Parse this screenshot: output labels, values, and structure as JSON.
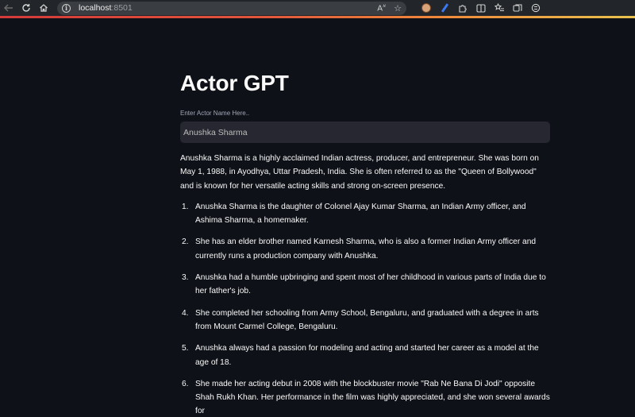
{
  "browser": {
    "url_host": "localhost",
    "url_port": ":8501"
  },
  "app": {
    "title": "Actor GPT",
    "input_label": "Enter Actor Name Here..",
    "input_value": "Anushka Sharma",
    "intro": "Anushka Sharma is a highly acclaimed Indian actress, producer, and entrepreneur. She was born on May 1, 1988, in Ayodhya, Uttar Pradesh, India. She is often referred to as the \"Queen of Bollywood\" and is known for her versatile acting skills and strong on-screen presence.",
    "facts": [
      {
        "num": "1.",
        "text": "Anushka Sharma is the daughter of Colonel Ajay Kumar Sharma, an Indian Army officer, and Ashima Sharma, a homemaker."
      },
      {
        "num": "2.",
        "text": "She has an elder brother named Karnesh Sharma, who is also a former Indian Army officer and currently runs a production company with Anushka."
      },
      {
        "num": "3.",
        "text": "Anushka had a humble upbringing and spent most of her childhood in various parts of India due to her father's job."
      },
      {
        "num": "4.",
        "text": "She completed her schooling from Army School, Bengaluru, and graduated with a degree in arts from Mount Carmel College, Bengaluru."
      },
      {
        "num": "5.",
        "text": "Anushka always had a passion for modeling and acting and started her career as a model at the age of 18."
      },
      {
        "num": "6.",
        "text": "She made her acting debut in 2008 with the blockbuster movie \"Rab Ne Bana Di Jodi\" opposite Shah Rukh Khan. Her performance in the film was highly appreciated, and she won several awards for"
      }
    ]
  }
}
